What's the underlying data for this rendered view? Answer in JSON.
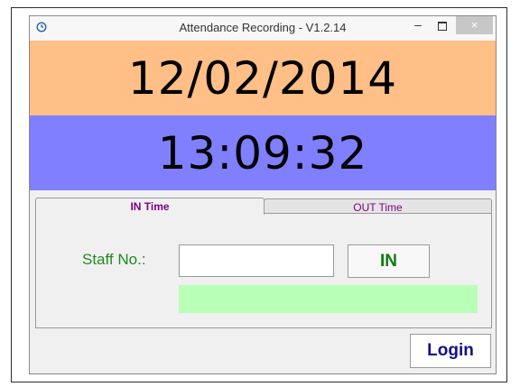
{
  "window": {
    "title": "Attendance Recording - V1.2.14",
    "controls": {
      "minimize": "–",
      "close": "×"
    }
  },
  "clock": {
    "date": "12/02/2014",
    "time": "13:09:32",
    "date_bg": "#ffbf86",
    "time_bg": "#7f7fff"
  },
  "tabs": [
    {
      "label": "IN Time",
      "selected": true
    },
    {
      "label": "OUT Time",
      "selected": false
    }
  ],
  "form": {
    "staff_label": "Staff No.:",
    "staff_value": "",
    "in_button": "IN",
    "status_text": "",
    "status_color": "#b8ffb8"
  },
  "footer": {
    "login_button": "Login"
  }
}
